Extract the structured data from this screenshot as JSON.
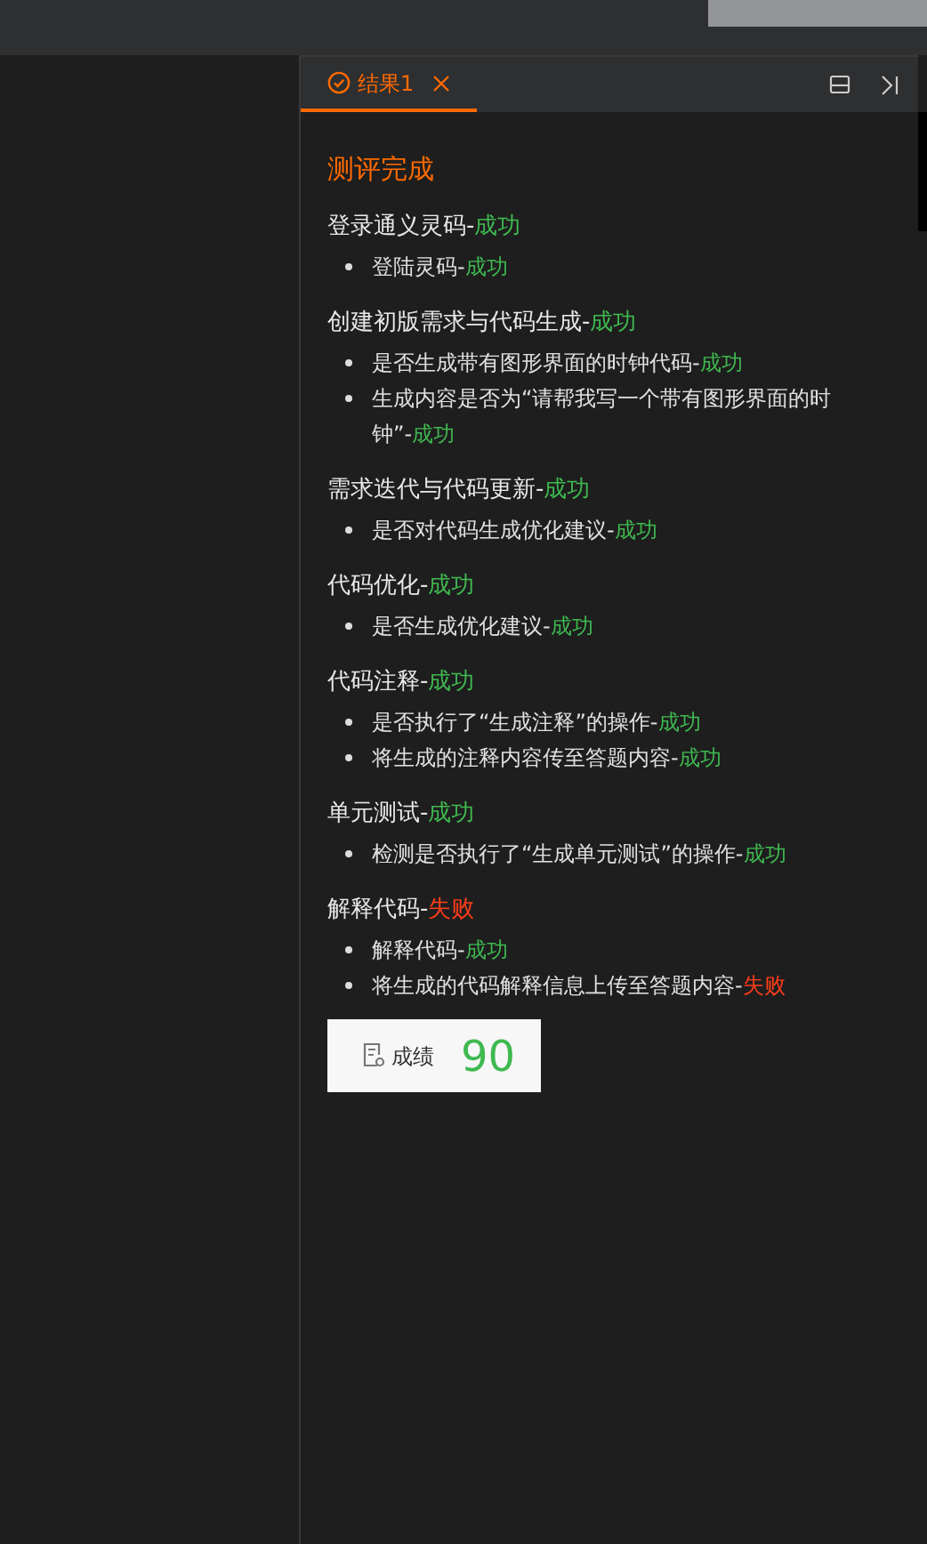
{
  "tab": {
    "label": "结果1",
    "selected": true
  },
  "title": "测评完成",
  "sections": [
    {
      "label": "登录通义灵码-",
      "result": "成功",
      "kind": "success",
      "items": [
        {
          "label": "登陆灵码-",
          "result": "成功",
          "kind": "success"
        }
      ]
    },
    {
      "label": "创建初版需求与代码生成-",
      "result": "成功",
      "kind": "success",
      "items": [
        {
          "label": "是否生成带有图形界面的时钟代码-",
          "result": "成功",
          "kind": "success"
        },
        {
          "label": "生成内容是否为“请帮我写一个带有图形界面的时钟”-",
          "result": "成功",
          "kind": "success"
        }
      ]
    },
    {
      "label": "需求迭代与代码更新-",
      "result": "成功",
      "kind": "success",
      "items": [
        {
          "label": "是否对代码生成优化建议-",
          "result": "成功",
          "kind": "success"
        }
      ]
    },
    {
      "label": "代码优化-",
      "result": "成功",
      "kind": "success",
      "items": [
        {
          "label": "是否生成优化建议-",
          "result": "成功",
          "kind": "success"
        }
      ]
    },
    {
      "label": "代码注释-",
      "result": "成功",
      "kind": "success",
      "items": [
        {
          "label": "是否执行了“生成注释”的操作-",
          "result": "成功",
          "kind": "success"
        },
        {
          "label": "将生成的注释内容传至答题内容-",
          "result": "成功",
          "kind": "success"
        }
      ]
    },
    {
      "label": "单元测试-",
      "result": "成功",
      "kind": "success",
      "items": [
        {
          "label": "检测是否执行了“生成单元测试”的操作-",
          "result": "成功",
          "kind": "success"
        }
      ]
    },
    {
      "label": "解释代码-",
      "result": "失败",
      "kind": "fail",
      "items": [
        {
          "label": "解释代码-",
          "result": "成功",
          "kind": "success"
        },
        {
          "label": "将生成的代码解释信息上传至答题内容-",
          "result": "失败",
          "kind": "fail"
        }
      ]
    }
  ],
  "score": {
    "label": "成绩",
    "value": "90"
  }
}
